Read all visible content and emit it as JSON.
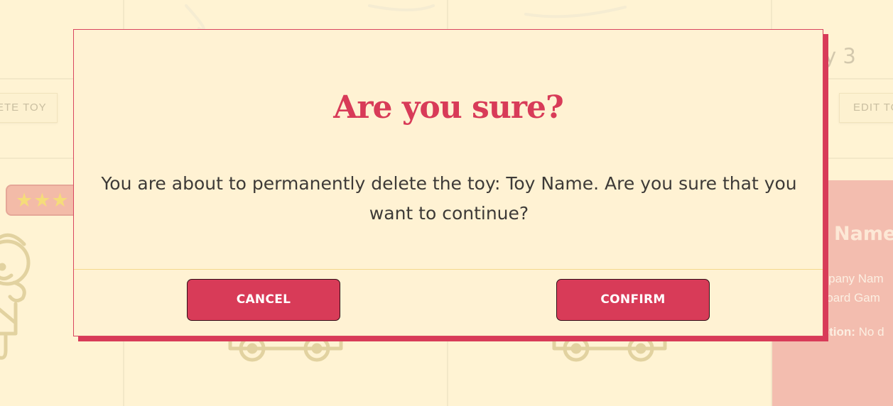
{
  "background": {
    "left_button_label": "ETE TOY",
    "right_button_label": "EDIT TO",
    "card_title_fragment": "y 3",
    "rating_stars": "★★★",
    "details_card": {
      "title_fragment": "y Name",
      "company_fragment": "mpany Nam",
      "category_fragment": "Board Gam",
      "description_label_fragment": "iption:",
      "description_value_fragment": "No d"
    }
  },
  "modal": {
    "title": "Are you sure?",
    "message_line_1": "You are about to permanently delete the toy: Toy Name. Are you sure that you",
    "message_line_2": "want to continue?",
    "cancel_label": "CANCEL",
    "confirm_label": "CONFIRM"
  },
  "colors": {
    "page_background": "#fff3d3",
    "accent": "#d83b58",
    "text": "#3d3a37",
    "card_pink": "#f3bdaf"
  }
}
